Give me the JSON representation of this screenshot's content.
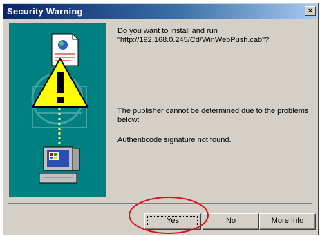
{
  "window": {
    "title": "Security Warning",
    "close_label": "×"
  },
  "messages": {
    "question": "Do you want to install and run \"http://192.168.0.245/Cd/WinWebPush.cab\"?",
    "publisher": "The publisher cannot be determined due to the problems below:",
    "authenticode": "Authenticode signature not found."
  },
  "buttons": {
    "yes": "Yes",
    "no": "No",
    "more_info": "More Info"
  },
  "colors": {
    "art_background": "#008080",
    "title_bar": "#0a246a",
    "annotation": "#e0101a"
  }
}
